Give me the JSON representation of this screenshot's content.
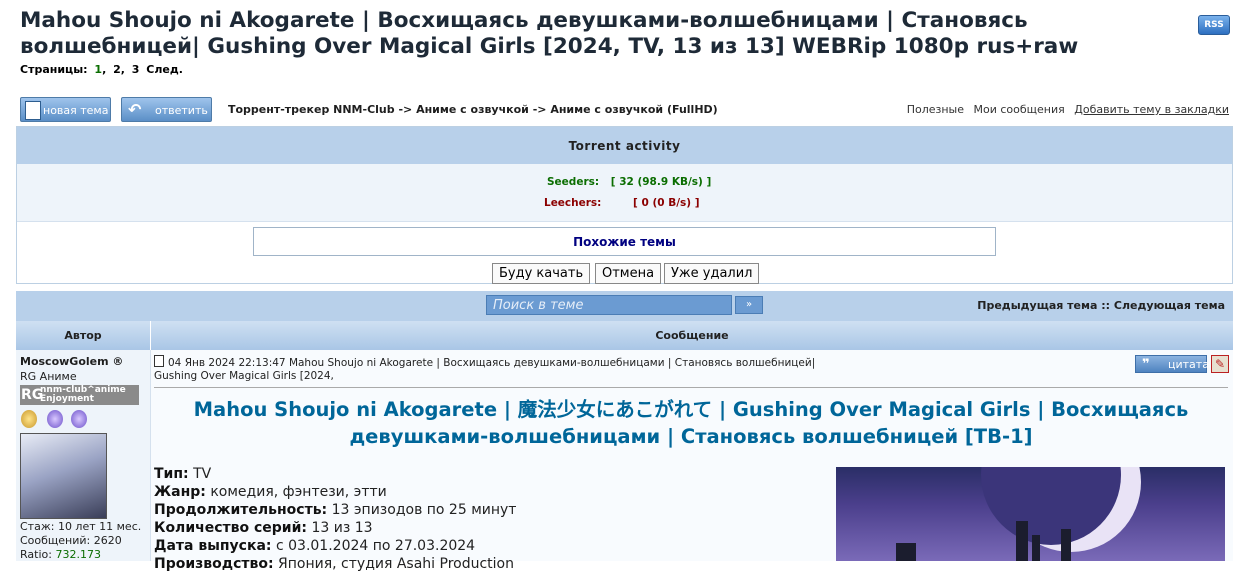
{
  "topic": {
    "title": "Mahou Shoujo ni Akogarete | Восхищаясь девушками-волшебницами | Становясь волшебницей| Gushing Over Magical Girls [2024, TV, 13 из 13] WEBRip 1080p rus+raw",
    "rss_label": "RSS"
  },
  "pages": {
    "label": "Страницы:",
    "items": [
      "1",
      "2",
      "3"
    ],
    "next": "След."
  },
  "toolbar": {
    "new_topic": "новая тема",
    "reply": "ответить",
    "breadcrumb": "Торрент-трекер NNM-Club -> Аниме с озвучкой -> Аниме с озвучкой (FullHD)",
    "links": [
      "Полезные",
      "Мои сообщения",
      "Добавить тему в закладки"
    ]
  },
  "activity": {
    "header": "Torrent activity",
    "seeders_label": "Seeders:",
    "seeders_value": "[ 32  (98.9 KB/s) ]",
    "leechers_label": "Leechers:",
    "leechers_value": "[ 0  (0 B/s) ]",
    "similar_link": "Похожие темы",
    "buttons": [
      "Буду качать",
      "Отмена",
      "Уже удалил"
    ]
  },
  "topicbar": {
    "search_placeholder": "Поиск в теме",
    "search_button": "»",
    "prev": "Предыдущая тема",
    "separator": "::",
    "next": "Следующая тема"
  },
  "table": {
    "col_author": "Автор",
    "col_message": "Сообщение"
  },
  "author": {
    "name": "MoscowGolem ®",
    "rank": "RG Аниме",
    "badge_rg": "RG",
    "badge_line1": "nnm-club^anime",
    "badge_line2": "Enjoyment",
    "stage": "Стаж: 10 лет 11 мес.",
    "messages": "Сообщений: 2620",
    "ratio_label": "Ratio: ",
    "ratio_value": "732.173"
  },
  "post": {
    "header": "04 Янв 2024 22:13:47  Mahou Shoujo ni Akogarete | Восхищаясь девушками-волшебницами | Становясь волшебницей| Gushing Over Magical Girls [2024,",
    "quote_label": "цитата",
    "title": "Mahou Shoujo ni Akogarete | 魔法少女にあこがれて | Gushing Over Magical Girls | Восхищаясь девушками-волшебницами | Становясь волшебницей [ТВ-1]",
    "details": [
      {
        "label": "Тип:",
        "value": "TV"
      },
      {
        "label": "Жанр:",
        "links": [
          "комедия",
          "фэнтези"
        ],
        "value": ", этти"
      },
      {
        "label": "Продолжительность:",
        "value": "13 эпизодов по 25 минут"
      },
      {
        "label": "Количество серий:",
        "value": "13 из 13"
      },
      {
        "label": "Дата выпуска:",
        "value": "с 03.01.2024 по 27.03.2024"
      },
      {
        "label": "Производство:",
        "value": "Япония, студия Asahi Production"
      }
    ]
  },
  "colors": {
    "header_bg": "#b8d0ea",
    "title": "#1e2a37",
    "post_title": "#006699",
    "seeders": "#0a6d00",
    "leechers": "#8b0000"
  }
}
